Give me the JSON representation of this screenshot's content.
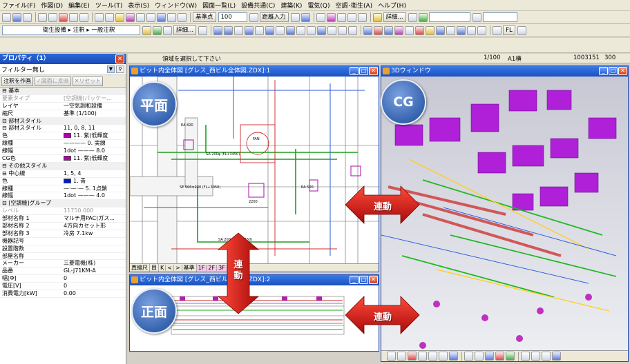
{
  "menu": [
    "ファイル(F)",
    "作図(D)",
    "編集(E)",
    "ツール(T)",
    "表示(S)",
    "ウィンドウ(W)",
    "図面一覧(L)",
    "設備共通(C)",
    "建築(K)",
    "電気(Q)",
    "空調･衛生(A)",
    "ヘルプ(H)"
  ],
  "toolbar1": {
    "base_point_label": "基準点",
    "scale_value": "100",
    "distance_input": "距離入力",
    "detail_button": "詳細..."
  },
  "toolbar2": {
    "breadcrumb": "衛生設備 ▸ 注釈 ▸ 一般注釈",
    "detail_button": "詳細...",
    "fl_label": "FL"
  },
  "status": {
    "message": "領域を選択して下さい",
    "scale": "1/100",
    "paper": "A1横",
    "coord_x": "1003151",
    "coord_y": "300"
  },
  "property_panel": {
    "title": "プロパティ（1）",
    "filter": "フィルター無し",
    "btn_annotate": "注釈を作画",
    "btn_reflect": "図面に反映",
    "btn_reset": "リセット",
    "rows": [
      {
        "k": "⊟ 基本",
        "v": "",
        "type": "sec"
      },
      {
        "k": "  要素タイプ",
        "v": "[空調機(パッケー...",
        "type": "gray"
      },
      {
        "k": "  レイヤ",
        "v": "一空気調和設備",
        "type": ""
      },
      {
        "k": "  縮尺",
        "v": "基準 (1/100)",
        "type": ""
      },
      {
        "k": "⊟ 部材スタイル",
        "v": "",
        "type": "sec"
      },
      {
        "k": "  ⊟ 部材スタイル",
        "v": "11, 0, 8, 11",
        "type": ""
      },
      {
        "k": "      色",
        "v": "11. 紫(低輝度",
        "type": "",
        "swatch": "#b000a8"
      },
      {
        "k": "      線種",
        "v": "———— 0. 実線",
        "type": ""
      },
      {
        "k": "      線幅",
        "v": "1dot ——— 8.0",
        "type": ""
      },
      {
        "k": "      CG色",
        "v": "11. 紫(低輝度",
        "type": "",
        "swatch": "#b000a8"
      },
      {
        "k": "⊟ その他スタイル",
        "v": "",
        "type": "sec"
      },
      {
        "k": "  ⊟ 中心線",
        "v": "1, 5, 4",
        "type": ""
      },
      {
        "k": "      色",
        "v": "1. 青",
        "type": "",
        "swatch": "#0018d8"
      },
      {
        "k": "      線種",
        "v": "—·—·— 5. 1点鎖",
        "type": ""
      },
      {
        "k": "      線幅",
        "v": "1dot ——— 4.0",
        "type": ""
      },
      {
        "k": "⊟ [空調機]グループ",
        "v": "",
        "type": "sec"
      },
      {
        "k": "  レベル",
        "v": "11750.000",
        "type": "gray"
      },
      {
        "k": "  部材名称 1",
        "v": "マルチ用PAC(ガス...",
        "type": ""
      },
      {
        "k": "  部材名称 2",
        "v": "4方向カセット形",
        "type": ""
      },
      {
        "k": "  部材名称 3",
        "v": "冷房 7.1kw",
        "type": ""
      },
      {
        "k": "  機器記号",
        "v": "",
        "type": ""
      },
      {
        "k": "  設置階数",
        "v": "",
        "type": ""
      },
      {
        "k": "  部屋名称",
        "v": "",
        "type": ""
      },
      {
        "k": "  メーカー",
        "v": "三菱電機(株)",
        "type": ""
      },
      {
        "k": "  品番",
        "v": "GL-J71KM-A",
        "type": ""
      },
      {
        "k": "  幅[Φ]",
        "v": "0",
        "type": ""
      },
      {
        "k": "  電圧[V]",
        "v": "0",
        "type": ""
      },
      {
        "k": "  消費電力[kW]",
        "v": "0.00",
        "type": ""
      }
    ]
  },
  "windows": {
    "plan": {
      "title": "ピット内全体図 [グレス_西ビル全体図.ZDX]:1",
      "tabs": [
        "真縮尺",
        "目",
        "K",
        "<",
        ">",
        "基準",
        "1F",
        "2F",
        "3F",
        "RF"
      ]
    },
    "front": {
      "title": "ピット内全体図 [グレス_西ビル全体図.ZDX]:2"
    },
    "cg": {
      "title": "3Dウィンドウ"
    }
  },
  "plan_labels": {
    "ea": "EA 820",
    "sa1": "SA 200φ (FL+3450)",
    "se": "SE 500×200 (FL+3050)",
    "sa2": "SA 200φ (FL+3150)",
    "fan": "FAN",
    "ea2": "EA 500",
    "dim": "2200"
  },
  "callouts": {
    "plan": "平面",
    "cg": "CG",
    "front": "正面",
    "link_h1": "連動",
    "link_v": "連\n動",
    "link_h2": "連動"
  },
  "colors": {
    "accent": "#1a50c0",
    "arrow": "#d81818",
    "cg_purple": "#b020d8"
  }
}
